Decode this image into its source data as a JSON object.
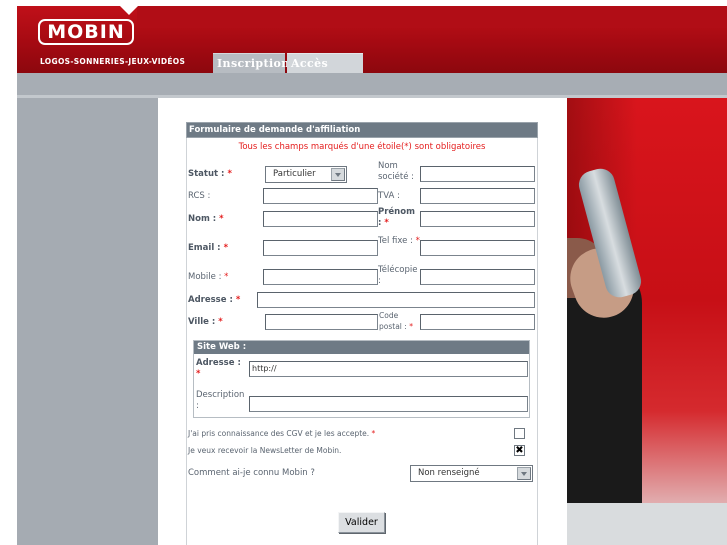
{
  "header": {
    "logo_text": "MOBIN",
    "tagline": "LOGOS-SONNERIES-JEUX-VIDÉOS",
    "tabs": [
      {
        "label": "Inscription"
      },
      {
        "label": "Accès client"
      }
    ]
  },
  "form": {
    "title": "Formulaire de demande d'affiliation",
    "required_note": "Tous les champs marqués d'une étoile(*) sont obligatoires",
    "star": "*",
    "statut": {
      "label": "Statut :",
      "selected": "Particulier"
    },
    "nom_societe": {
      "label": "Nom société :",
      "value": ""
    },
    "rcs": {
      "label": "RCS :",
      "value": ""
    },
    "tva": {
      "label": "TVA :",
      "value": ""
    },
    "nom": {
      "label": "Nom :",
      "value": ""
    },
    "prenom": {
      "label": "Prénom :",
      "value": ""
    },
    "email": {
      "label": "Email :",
      "value": ""
    },
    "tel_fixe": {
      "label": "Tel fixe :",
      "value": ""
    },
    "mobile": {
      "label": "Mobile :",
      "value": ""
    },
    "telecopie": {
      "label": "Télécopie :",
      "value": ""
    },
    "adresse": {
      "label": "Adresse :",
      "value": ""
    },
    "ville": {
      "label": "Ville :",
      "value": ""
    },
    "code_postal": {
      "label": "Code postal :",
      "value": ""
    },
    "site_web": {
      "title": "Site Web :",
      "adresse_label": "Adresse :",
      "adresse_value": "http://",
      "description_label": "Description :",
      "description_value": ""
    },
    "cgv": {
      "label": "J'ai pris connaissance des CGV et je les accepte.",
      "checked": false
    },
    "newsletter": {
      "label": "Je veux recevoir la NewsLetter de Mobin.",
      "checked": true,
      "mark": "✖"
    },
    "source": {
      "label": "Comment ai-je connu Mobin ?",
      "selected": "Non renseigné"
    },
    "submit_label": "Valider"
  },
  "colors": {
    "brand_red": "#b10d16",
    "panel_grey": "#a5abb2",
    "header_slate": "#6e7a85",
    "required_red": "#e41d1d"
  }
}
